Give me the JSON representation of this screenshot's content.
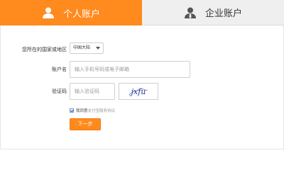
{
  "tabs": {
    "personal": {
      "label": "个人账户",
      "icon": "user-icon"
    },
    "enterprise": {
      "label": "企业账户",
      "icon": "business-user-icon"
    }
  },
  "form": {
    "country": {
      "label": "您所在的国家或地区",
      "value": "中国大陆"
    },
    "account": {
      "label": "账户名",
      "placeholder": "输入手机号码或电子邮箱"
    },
    "captcha": {
      "label": "验证码",
      "placeholder": "输入验证码",
      "image_text": "jxfu"
    },
    "agree": {
      "text": "我同意",
      "link": "支付宝服务协议"
    },
    "next_label": "下一步"
  },
  "colors": {
    "accent": "#ff8a1e",
    "tab_inactive": "#efefef"
  }
}
